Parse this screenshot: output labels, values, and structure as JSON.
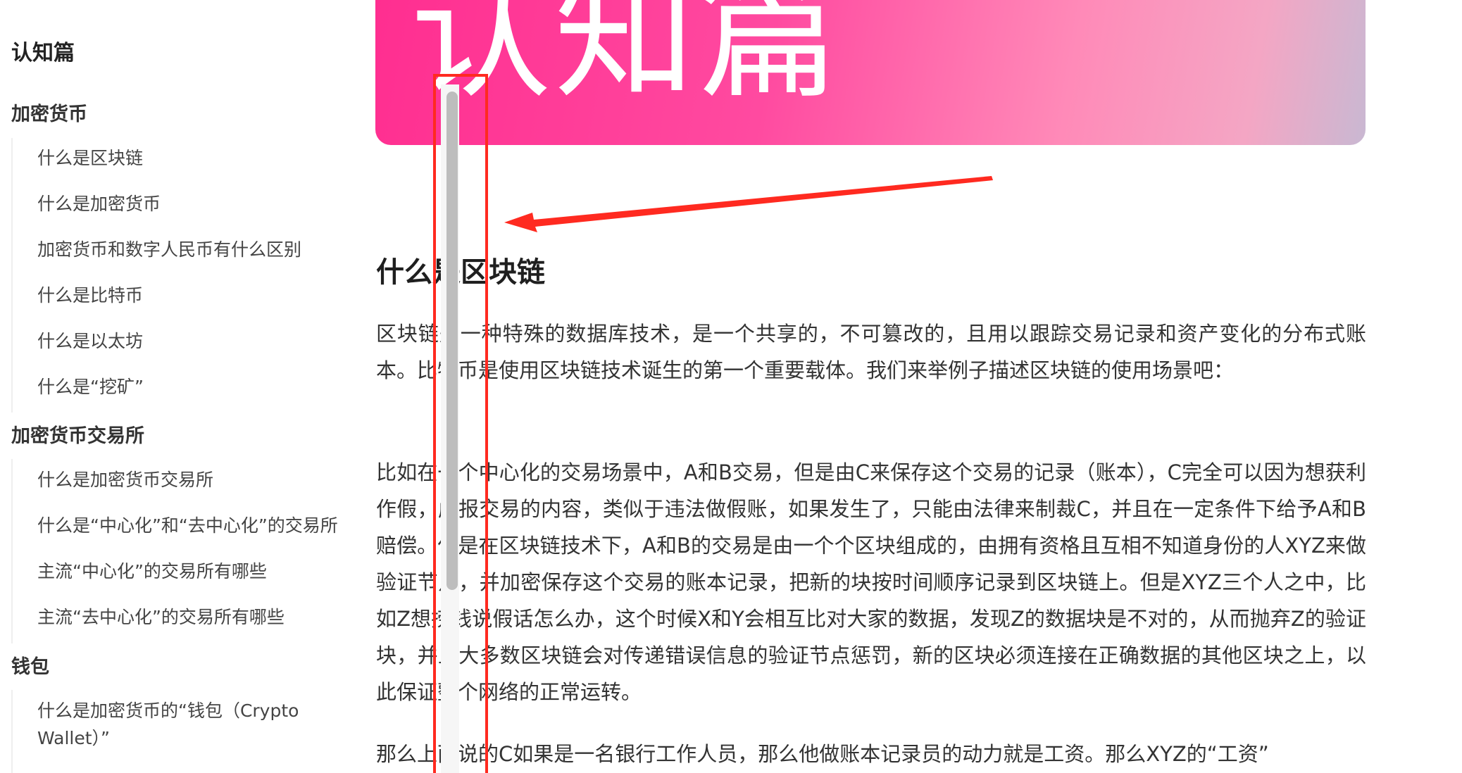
{
  "sidebar": {
    "root_title": "认知篇",
    "sections": [
      {
        "title": "加密货币",
        "items": [
          "什么是区块链",
          "什么是加密货币",
          "加密货币和数字人民币有什么区别",
          "什么是比特币",
          "什么是以太坊",
          "什么是“挖矿”"
        ]
      },
      {
        "title": "加密货币交易所",
        "items": [
          "什么是加密货币交易所",
          "什么是“中心化”和“去中心化”的交易所",
          "主流“中心化”的交易所有哪些",
          "主流“去中心化”的交易所有哪些"
        ]
      },
      {
        "title": "钱包",
        "items": [
          "什么是加密货币的“钱包（Crypto Wallet）”"
        ]
      }
    ]
  },
  "banner": {
    "title": "认知篇"
  },
  "article": {
    "title": "什么是区块链",
    "paragraphs": [
      "区块链是一种特殊的数据库技术，是一个共享的，不可篡改的，且用以跟踪交易记录和资产变化的分布式账本。比特币是使用区块链技术诞生的第一个重要载体。我们来举例子描述区块链的使用场景吧：",
      "比如在一个中心化的交易场景中，A和B交易，但是由C来保存这个交易的记录（账本），C完全可以因为想获利作假，虚报交易的内容，类似于违法做假账，如果发生了，只能由法律来制裁C，并且在一定条件下给予A和B赔偿。但是在区块链技术下，A和B的交易是由一个个区块组成的，由拥有资格且互相不知道身份的人XYZ来做验证节点，并加密保存这个交易的账本记录，把新的块按时间顺序记录到区块链上。但是XYZ三个人之中，比如Z想捞钱说假话怎么办，这个时候X和Y会相互比对大家的数据，发现Z的数据块是不对的，从而抛弃Z的验证块，并且大多数区块链会对传递错误信息的验证节点惩罚，新的区块必须连接在正确数据的其他区块之上，以此保证整个网络的正常运转。",
      "那么上面说的C如果是一名银行工作人员，那么他做账本记录员的动力就是工资。那么XYZ的“工资”"
    ]
  },
  "colors": {
    "annotation": "#ff2a20",
    "banner_start": "#ff2e90",
    "banner_end": "#c9b8d2",
    "scroll_thumb": "#bdbdbd"
  }
}
